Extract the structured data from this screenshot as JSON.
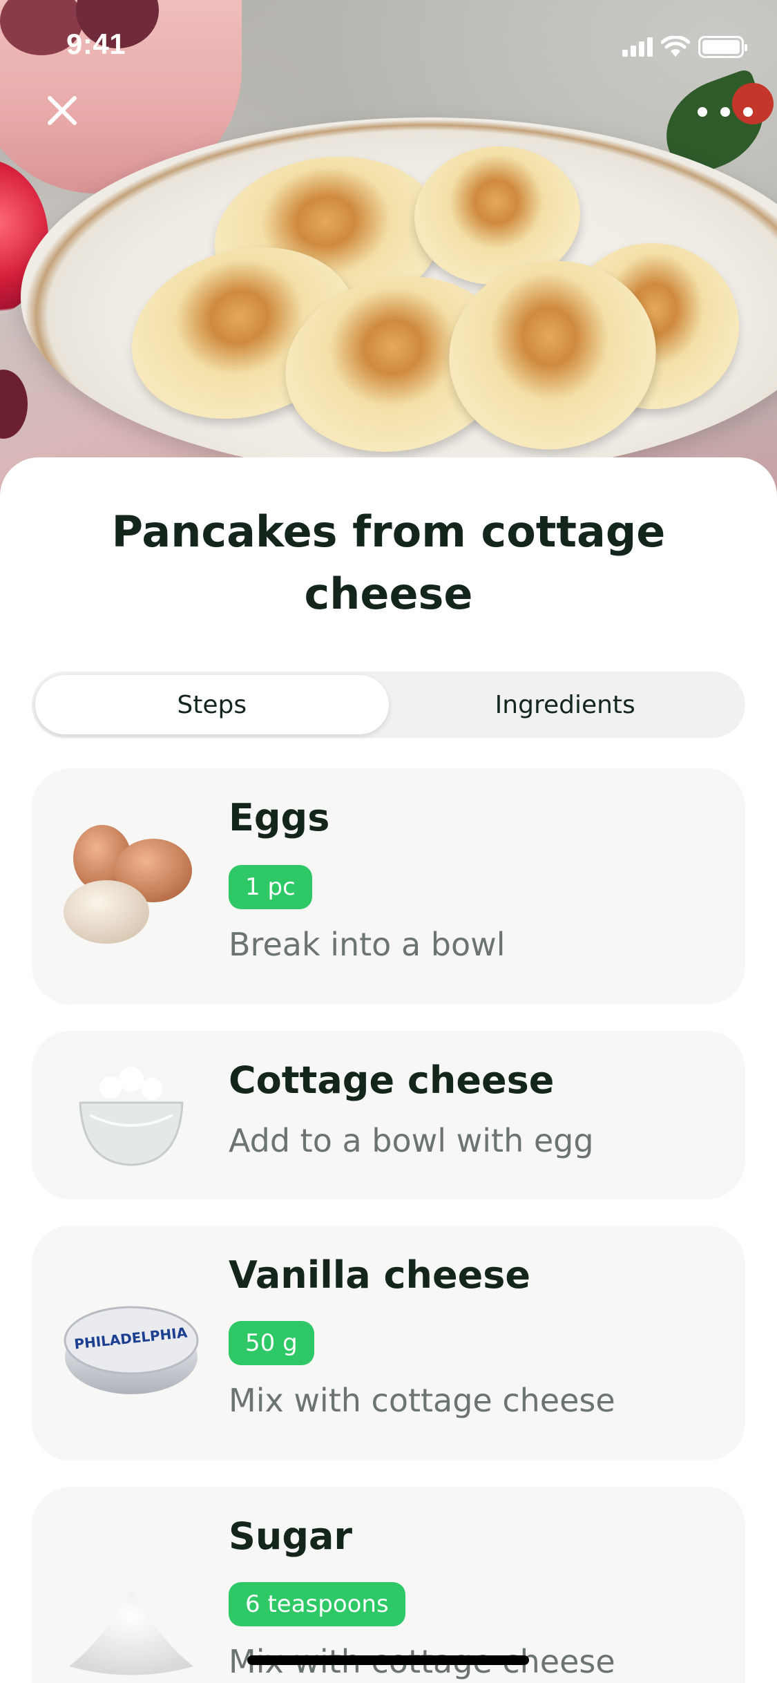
{
  "status_bar": {
    "time": "9:41"
  },
  "header": {
    "close_icon": "close-icon",
    "more_icon": "more-dots-icon"
  },
  "recipe": {
    "title": "Pancakes from cottage cheese"
  },
  "tabs": [
    {
      "label": "Steps",
      "selected": true
    },
    {
      "label": "Ingredients",
      "selected": false
    }
  ],
  "ingredients": [
    {
      "name": "Eggs",
      "amount": "1 pc",
      "instruction": "Break into a bowl",
      "image": "eggs"
    },
    {
      "name": "Cottage cheese",
      "amount": "",
      "instruction": "Add to a bowl with egg",
      "image": "cottage-cheese-bowl"
    },
    {
      "name": "Vanilla cheese",
      "amount": "50 g",
      "instruction": "Mix with cottage cheese",
      "image": "cream-cheese-tub",
      "image_text": "PHILADELPHIA"
    },
    {
      "name": "Sugar",
      "amount": "6 teaspoons",
      "instruction": "Mix with cottage cheese",
      "image": "sugar-pile"
    }
  ],
  "colors": {
    "accent": "#2ec866",
    "title": "#14261c",
    "muted": "#6b7470",
    "card": "#f7f7f6"
  }
}
